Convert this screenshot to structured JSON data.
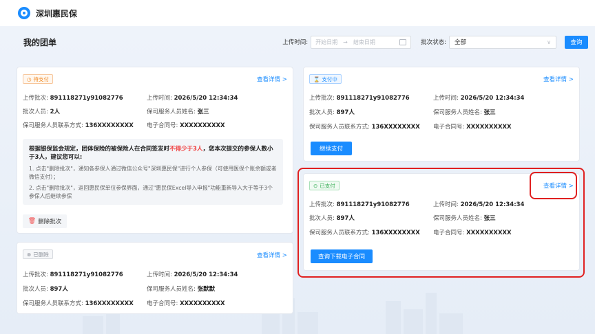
{
  "app": {
    "title": "深圳惠民保",
    "logo_icon": "app-logo-icon"
  },
  "page": {
    "title": "我的团单"
  },
  "filters": {
    "upload_time_label": "上传时间:",
    "start_placeholder": "开始日期",
    "arrow": "→",
    "end_placeholder": "结束日期",
    "batch_status_label": "批次状态:",
    "batch_status_value": "全部",
    "query_label": "查询"
  },
  "labels": {
    "batch_no": "上传批次:",
    "upload_time": "上传时间:",
    "batch_people": "批次人员:",
    "staff_name": "保司服务人员姓名:",
    "staff_phone": "保司服务人员联系方式:",
    "contract_no": "电子合同号:",
    "detail_link": "查看详情 >"
  },
  "cards": [
    {
      "status": "待支付",
      "batch_no": "891118271y91082776",
      "upload_time": "2026/5/20 12:34:34",
      "people": "2人",
      "staff_name": "张三",
      "phone": "136XXXXXXXX",
      "contract": "XXXXXXXXXX",
      "notice": {
        "title_part1": "根据银保监会规定，团体保险的被保险人在合同签发时",
        "title_red": "不得少于3人",
        "title_part2": "，您本次提交的参保人数小于3人，建议您可以:",
        "item1": "1. 点击\"删除批次\"，通知各参保人通过微信公众号\"深圳惠民保\"进行个人参保（可使用医保个账余额或者微信支付）；",
        "item2": "2. 点击\"删除批次\"，返回惠民保单位参保界面，通过\"惠民保Excel导入申报\"功能重新导入大于等于3个参保人后继续参保"
      },
      "delete_label": "删除批次"
    },
    {
      "status": "已删除",
      "batch_no": "891118271y91082776",
      "upload_time": "2026/5/20 12:34:34",
      "people": "897人",
      "staff_name": "张默默",
      "phone": "136XXXXXXXX",
      "contract": "XXXXXXXXXX"
    },
    {
      "status": "支付中",
      "batch_no": "891118271y91082776",
      "upload_time": "2026/5/20 12:34:34",
      "people": "897人",
      "staff_name": "张三",
      "phone": "136XXXXXXXX",
      "contract": "XXXXXXXXXX",
      "action_label": "继续支付"
    },
    {
      "status": "已支付",
      "batch_no": "891118271y91082776",
      "upload_time": "2026/5/20 12:34:34",
      "people": "897人",
      "staff_name": "张三",
      "phone": "136XXXXXXXX",
      "contract": "XXXXXXXXXX",
      "action_label": "查询下载电子合同"
    }
  ],
  "colors": {
    "accent": "#1a8cff",
    "highlight": "#e02020",
    "warning": "#f08a24",
    "success": "#2faa4e"
  }
}
